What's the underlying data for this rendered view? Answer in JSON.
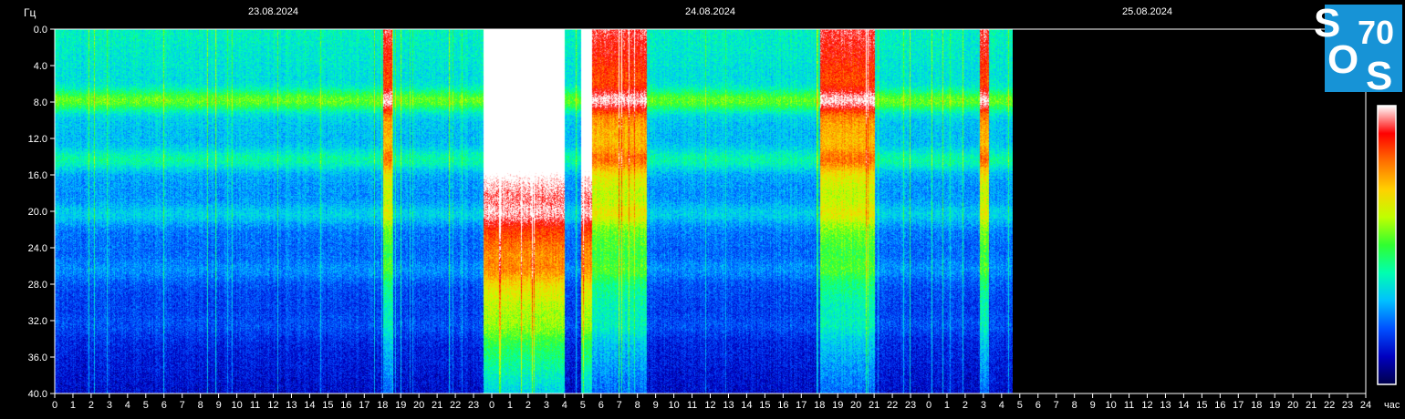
{
  "chart_data": {
    "type": "heatmap",
    "title": "",
    "ylabel": "Гц",
    "xlabel": "час",
    "ylim": [
      0,
      40
    ],
    "y_ticks": [
      "0.0",
      "4.0",
      "8.0",
      "12.0",
      "16.0",
      "20.0",
      "24.0",
      "28.0",
      "32.0",
      "36.0",
      "40.0"
    ],
    "x_ticks": [
      "0",
      "1",
      "2",
      "3",
      "4",
      "5",
      "6",
      "7",
      "8",
      "9",
      "10",
      "11",
      "12",
      "13",
      "14",
      "15",
      "16",
      "17",
      "18",
      "19",
      "20",
      "21",
      "22",
      "23",
      "0",
      "1",
      "2",
      "3",
      "4",
      "5",
      "6",
      "7",
      "8",
      "9",
      "10",
      "11",
      "12",
      "13",
      "14",
      "15",
      "16",
      "17",
      "18",
      "19",
      "20",
      "21",
      "22",
      "23",
      "0",
      "1",
      "2",
      "3",
      "4",
      "5",
      "6",
      "7",
      "8",
      "9",
      "10",
      "11",
      "12",
      "13",
      "14",
      "15",
      "16",
      "17",
      "18",
      "19",
      "20",
      "21",
      "22",
      "23",
      "24"
    ],
    "dates": [
      "23.08.2024",
      "24.08.2024",
      "25.08.2024"
    ],
    "data_end_hours": 52.6,
    "resonance_bands_hz": [
      7.8,
      14.3,
      20.3,
      26.4,
      32.5
    ],
    "activity_bursts": [
      {
        "start_hour": 18.0,
        "end_hour": 18.5,
        "intensity": "high"
      },
      {
        "start_hour": 23.5,
        "end_hour": 28.0,
        "intensity": "saturated"
      },
      {
        "start_hour": 28.9,
        "end_hour": 29.5,
        "intensity": "saturated"
      },
      {
        "start_hour": 29.5,
        "end_hour": 32.5,
        "intensity": "high"
      },
      {
        "start_hour": 42.0,
        "end_hour": 45.0,
        "intensity": "high"
      },
      {
        "start_hour": 50.8,
        "end_hour": 51.3,
        "intensity": "high"
      }
    ],
    "colorbar": [
      "#00004a",
      "#0000c0",
      "#0050ff",
      "#00c0ff",
      "#00ffb0",
      "#30ff30",
      "#c0ff00",
      "#ffd000",
      "#ff7000",
      "#ff0000",
      "#ffffff"
    ],
    "grid": false,
    "legend": "colorbar right"
  },
  "logo": {
    "letters": [
      "S",
      "O",
      "S"
    ],
    "number": "70",
    "color": "#1793d6"
  }
}
